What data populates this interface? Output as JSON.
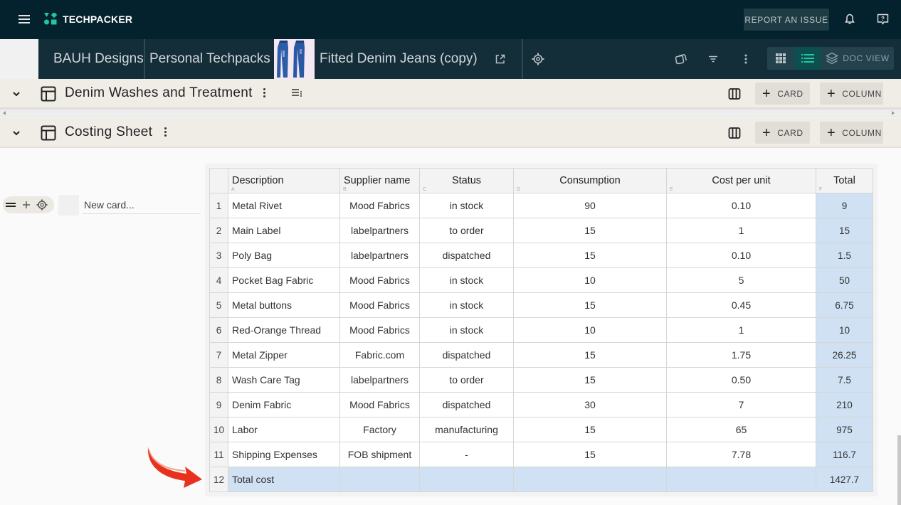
{
  "app": {
    "brand": "TECHPACKER",
    "report_label": "REPORT AN ISSUE",
    "icons": [
      "menu-icon",
      "bell-icon",
      "help-chat-icon"
    ]
  },
  "breadcrumb": {
    "items": [
      "BAUH Designs",
      "Personal Techpacks"
    ],
    "current": "Fitted Denim Jeans (copy)",
    "thumbnail": "jeans-thumbnail",
    "doc_view_label": "DOC VIEW"
  },
  "sections": [
    {
      "title": "Denim Washes and Treatment",
      "card_label": "CARD",
      "column_label": "COLUMN"
    },
    {
      "title": "Costing Sheet",
      "card_label": "CARD",
      "column_label": "COLUMN"
    }
  ],
  "card_input": {
    "placeholder": "New card..."
  },
  "table": {
    "columns": [
      {
        "label": "Description",
        "letter": "A"
      },
      {
        "label": "Supplier name",
        "letter": "B"
      },
      {
        "label": "Status",
        "letter": "C"
      },
      {
        "label": "Consumption",
        "letter": "D"
      },
      {
        "label": "Cost per unit",
        "letter": "E"
      },
      {
        "label": "Total",
        "letter": "F"
      }
    ],
    "rows": [
      {
        "n": "1",
        "description": "Metal Rivet",
        "supplier": "Mood Fabrics",
        "status": "in stock",
        "consumption": "90",
        "cost": "0.10",
        "total": "9"
      },
      {
        "n": "2",
        "description": "Main Label",
        "supplier": "labelpartners",
        "status": "to order",
        "consumption": "15",
        "cost": "1",
        "total": "15"
      },
      {
        "n": "3",
        "description": "Poly Bag",
        "supplier": "labelpartners",
        "status": "dispatched",
        "consumption": "15",
        "cost": "0.10",
        "total": "1.5"
      },
      {
        "n": "4",
        "description": "Pocket Bag Fabric",
        "supplier": "Mood Fabrics",
        "status": "in stock",
        "consumption": "10",
        "cost": "5",
        "total": "50"
      },
      {
        "n": "5",
        "description": "Metal buttons",
        "supplier": "Mood Fabrics",
        "status": "in stock",
        "consumption": "15",
        "cost": "0.45",
        "total": "6.75"
      },
      {
        "n": "6",
        "description": "Red-Orange Thread",
        "supplier": "Mood Fabrics",
        "status": "in stock",
        "consumption": "10",
        "cost": "1",
        "total": "10"
      },
      {
        "n": "7",
        "description": "Metal Zipper",
        "supplier": "Fabric.com",
        "status": "dispatched",
        "consumption": "15",
        "cost": "1.75",
        "total": "26.25"
      },
      {
        "n": "8",
        "description": "Wash Care Tag",
        "supplier": "labelpartners",
        "status": "to order",
        "consumption": "15",
        "cost": "0.50",
        "total": "7.5"
      },
      {
        "n": "9",
        "description": "Denim Fabric",
        "supplier": "Mood Fabrics",
        "status": "dispatched",
        "consumption": "30",
        "cost": "7",
        "total": "210"
      },
      {
        "n": "10",
        "description": "Labor",
        "supplier": "Factory",
        "status": "manufacturing",
        "consumption": "15",
        "cost": "65",
        "total": "975"
      },
      {
        "n": "11",
        "description": "Shipping Expenses",
        "supplier": "FOB shipment",
        "status": "-",
        "consumption": "15",
        "cost": "7.78",
        "total": "116.7"
      }
    ],
    "total_row": {
      "n": "12",
      "description": "Total cost",
      "total": "1427.7"
    }
  },
  "colors": {
    "topbar": "#04222e",
    "crumbbar": "#132d39",
    "accent": "#1fc7a6",
    "section_bg": "#f0ede7",
    "highlight_cell": "#cfe1f2",
    "annotation_arrow": "#e8321e"
  }
}
